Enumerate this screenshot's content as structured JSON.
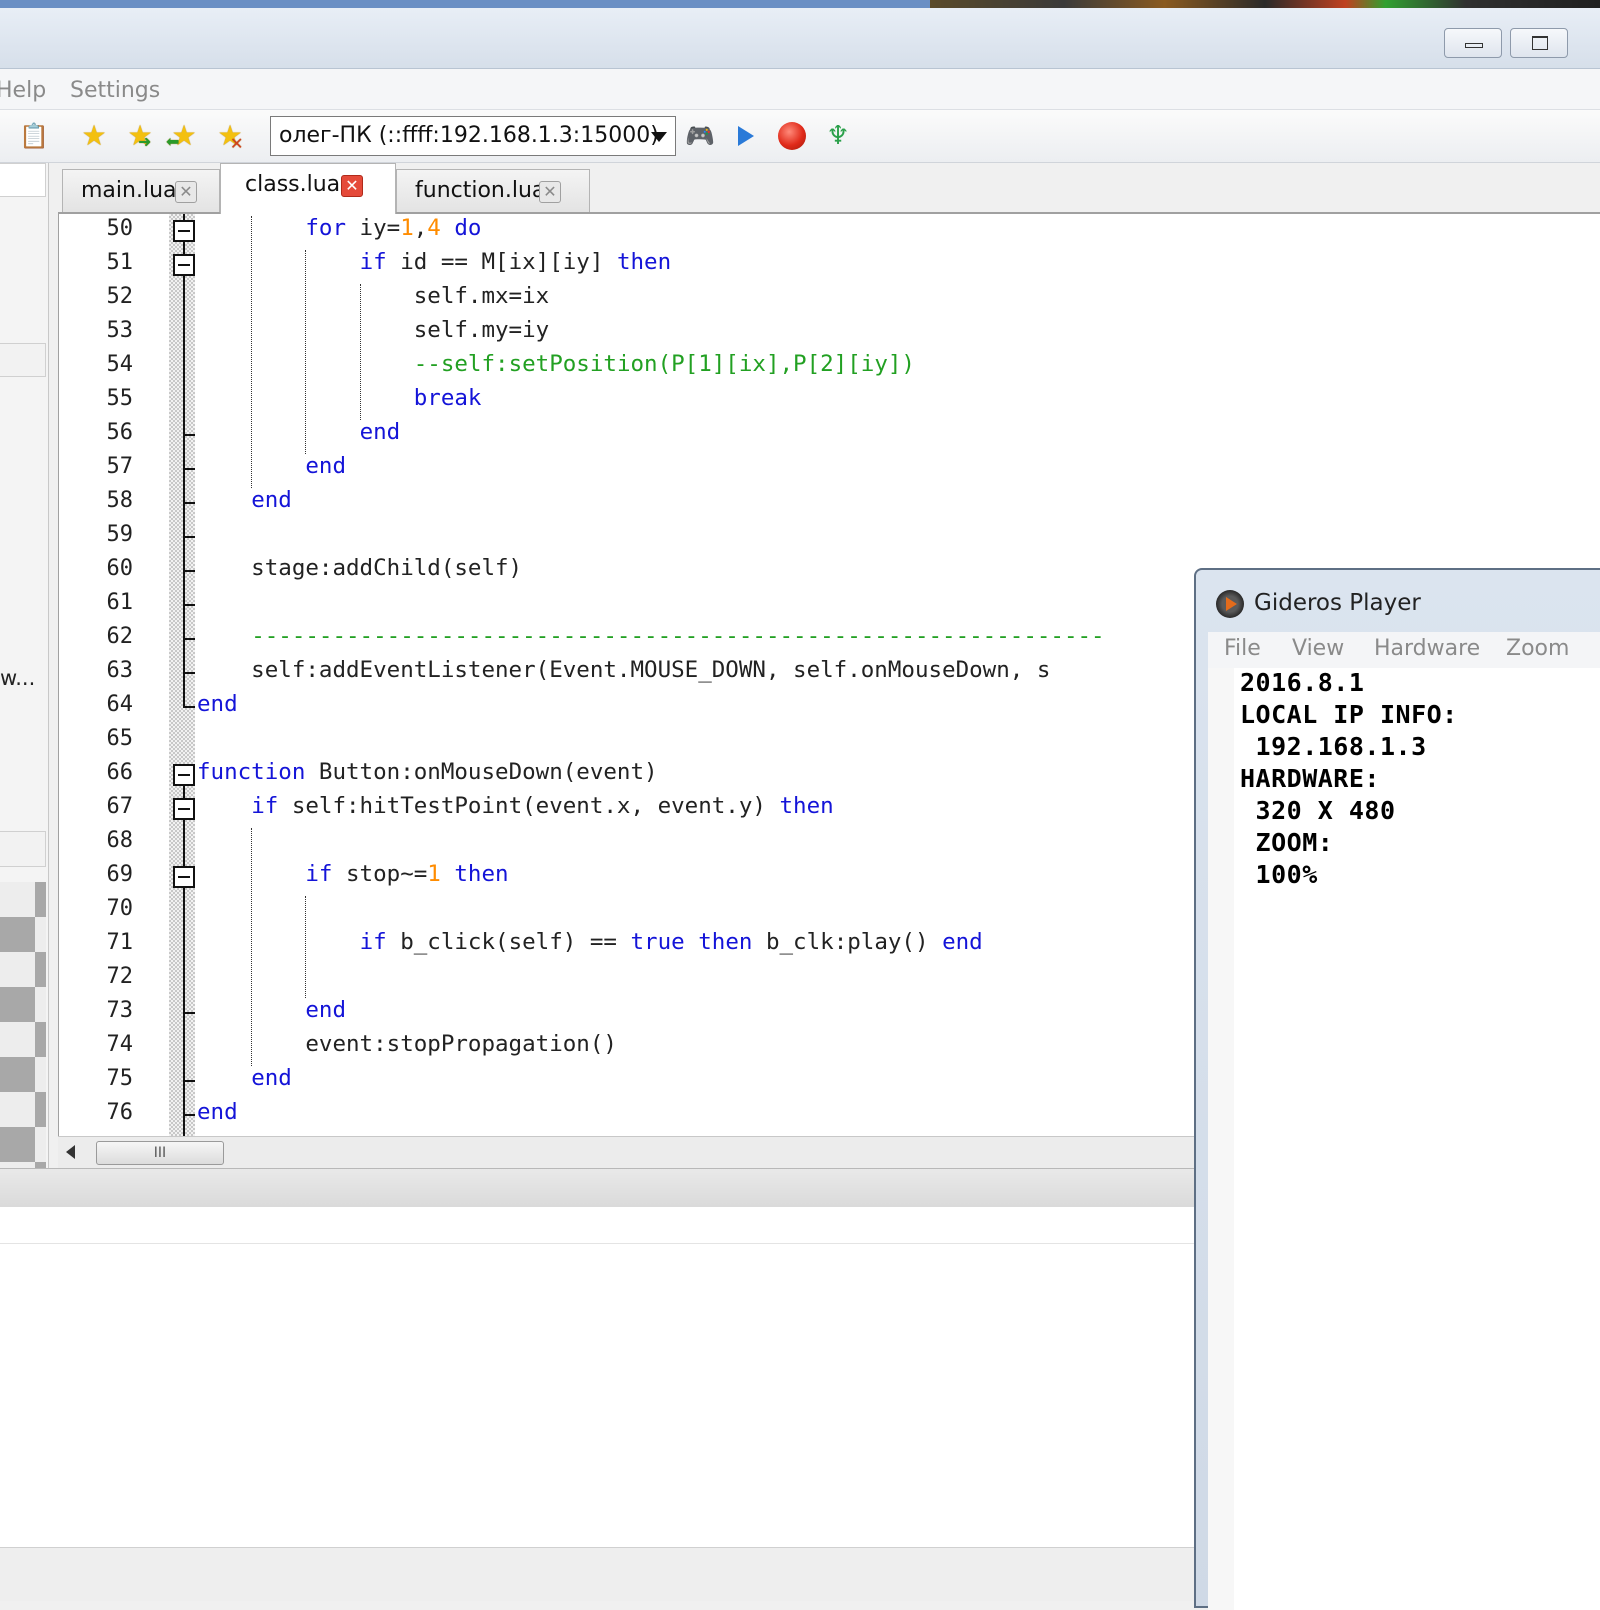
{
  "window": {
    "minimize_label": "",
    "maximize_label": ""
  },
  "menu": {
    "items": [
      "Help",
      "Settings"
    ]
  },
  "toolbar": {
    "device_combo": "олег-ПК (::ffff:192.168.1.3:15000)",
    "icons": [
      "paste-icon",
      "star-icon",
      "star-next-icon",
      "star-prev-icon",
      "star-clear-icon",
      "gamepad-icon",
      "play-icon",
      "stop-icon",
      "export-icon"
    ]
  },
  "left_panel": {
    "truncated_text": "w..."
  },
  "tabs": [
    {
      "label": "main.lua",
      "close": "✕"
    },
    {
      "label": "class.lua",
      "close": "✕"
    },
    {
      "label": "function.lua",
      "close": "✕"
    }
  ],
  "editor": {
    "lines": [
      {
        "n": "50",
        "code": "        for iy=1,4 do"
      },
      {
        "n": "51",
        "code": "            if id == M[ix][iy] then"
      },
      {
        "n": "52",
        "code": "                self.mx=ix"
      },
      {
        "n": "53",
        "code": "                self.my=iy"
      },
      {
        "n": "54",
        "code": "                --self:setPosition(P[1][ix],P[2][iy])"
      },
      {
        "n": "55",
        "code": "                break"
      },
      {
        "n": "56",
        "code": "            end"
      },
      {
        "n": "57",
        "code": "        end"
      },
      {
        "n": "58",
        "code": "    end"
      },
      {
        "n": "59",
        "code": ""
      },
      {
        "n": "60",
        "code": "    stage:addChild(self)"
      },
      {
        "n": "61",
        "code": ""
      },
      {
        "n": "62",
        "code": "    ---------------------------------------------------------------"
      },
      {
        "n": "63",
        "code": "    self:addEventListener(Event.MOUSE_DOWN, self.onMouseDown, s"
      },
      {
        "n": "64",
        "code": "end"
      },
      {
        "n": "65",
        "code": ""
      },
      {
        "n": "66",
        "code": "function Button:onMouseDown(event)"
      },
      {
        "n": "67",
        "code": "    if self:hitTestPoint(event.x, event.y) then"
      },
      {
        "n": "68",
        "code": ""
      },
      {
        "n": "69",
        "code": "        if stop~=1 then"
      },
      {
        "n": "70",
        "code": ""
      },
      {
        "n": "71",
        "code": "            if b_click(self) == true then b_clk:play() end"
      },
      {
        "n": "72",
        "code": ""
      },
      {
        "n": "73",
        "code": "        end"
      },
      {
        "n": "74",
        "code": "        event:stopPropagation()"
      },
      {
        "n": "75",
        "code": "    end"
      },
      {
        "n": "76",
        "code": "end"
      }
    ]
  },
  "scrollbar": {
    "thumb_grip": "III"
  },
  "player": {
    "title": "Gideros Player",
    "menu": [
      "File",
      "View",
      "Hardware",
      "Zoom"
    ],
    "info": [
      "2016.8.1",
      "LOCAL IP INFO:",
      " 192.168.1.3",
      "HARDWARE:",
      " 320 X 480",
      " ZOOM:",
      " 100%"
    ]
  },
  "colors": {
    "keyword": "#1414d8",
    "number": "#ff8c00",
    "comment": "#22a022",
    "text": "#222222"
  }
}
